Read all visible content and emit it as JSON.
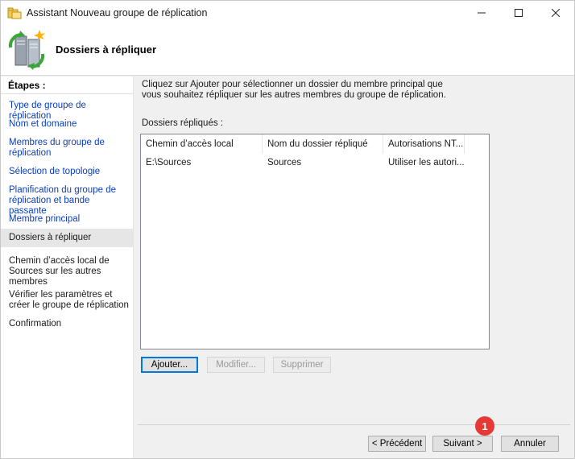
{
  "window": {
    "title": "Assistant Nouveau groupe de réplication",
    "controls": {
      "minimize_icon": "minimize-icon",
      "maximize_icon": "maximize-icon",
      "close_icon": "close-icon"
    }
  },
  "header": {
    "title": "Dossiers à répliquer",
    "icon": "replication-servers-icon"
  },
  "steps": {
    "heading": "Étapes :",
    "items": [
      {
        "label": "Type de groupe de réplication",
        "state": "link"
      },
      {
        "label": "Nom et domaine",
        "state": "link"
      },
      {
        "label": "Membres du groupe de réplication",
        "state": "link"
      },
      {
        "label": "Sélection de topologie",
        "state": "link"
      },
      {
        "label": "Planification du groupe de réplication et bande passante",
        "state": "link"
      },
      {
        "label": "Membre principal",
        "state": "link"
      },
      {
        "label": "Dossiers à répliquer",
        "state": "current"
      },
      {
        "label": "Chemin d’accès local de Sources sur les autres membres",
        "state": "pending"
      },
      {
        "label": "Vérifier les paramètres et créer le groupe de réplication",
        "state": "pending"
      },
      {
        "label": "Confirmation",
        "state": "pending"
      }
    ]
  },
  "main": {
    "instructions": "Cliquez sur Ajouter pour sélectionner un dossier du membre principal que vous souhaitez répliquer sur les autres membres du groupe de réplication.",
    "list_label": "Dossiers répliqués :",
    "columns": [
      "Chemin d’accès local",
      "Nom du dossier répliqué",
      "Autorisations NT..."
    ],
    "rows": [
      [
        "E:\\Sources",
        "Sources",
        "Utiliser les autori..."
      ]
    ],
    "buttons": {
      "add": "Ajouter...",
      "modify": "Modifier...",
      "delete": "Supprimer"
    }
  },
  "footer": {
    "buttons": {
      "previous": "< Précédent",
      "next": "Suivant >",
      "cancel": "Annuler"
    },
    "badge": "1",
    "badge_color": "#e53935"
  },
  "colors": {
    "link": "#0a3dbe",
    "default_button_border": "#0078d7"
  }
}
